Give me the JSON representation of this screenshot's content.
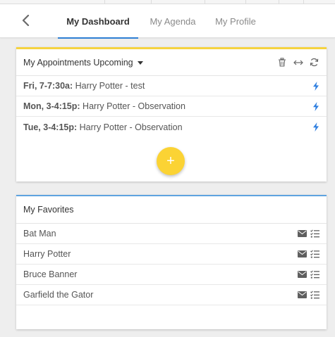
{
  "nav": {
    "back_icon": "chevron-left-icon",
    "tabs": [
      {
        "label": "My Dashboard",
        "active": true
      },
      {
        "label": "My Agenda",
        "active": false
      },
      {
        "label": "My Profile",
        "active": false
      }
    ]
  },
  "appointments": {
    "title": "My Appointments Upcoming",
    "header_icons": [
      "trash-icon",
      "expand-horizontal-icon",
      "refresh-icon"
    ],
    "items": [
      {
        "time": "Fri, 7-7:30a:",
        "description": "Harry Potter - test",
        "icon": "lightning-icon"
      },
      {
        "time": "Mon, 3-4:15p:",
        "description": "Harry Potter - Observation",
        "icon": "lightning-icon"
      },
      {
        "time": "Tue, 3-4:15p:",
        "description": "Harry Potter - Observation",
        "icon": "lightning-icon"
      }
    ],
    "add_button": "+"
  },
  "favorites": {
    "title": "My Favorites",
    "items": [
      {
        "name": "Bat Man"
      },
      {
        "name": "Harry Potter"
      },
      {
        "name": "Bruce Banner"
      },
      {
        "name": "Garfield the Gator"
      }
    ],
    "item_icons": [
      "envelope-icon",
      "checklist-icon"
    ]
  },
  "colors": {
    "accent_blue": "#2e7fd4",
    "accent_yellow": "#fbd334",
    "lightning": "#2f7fe0"
  }
}
